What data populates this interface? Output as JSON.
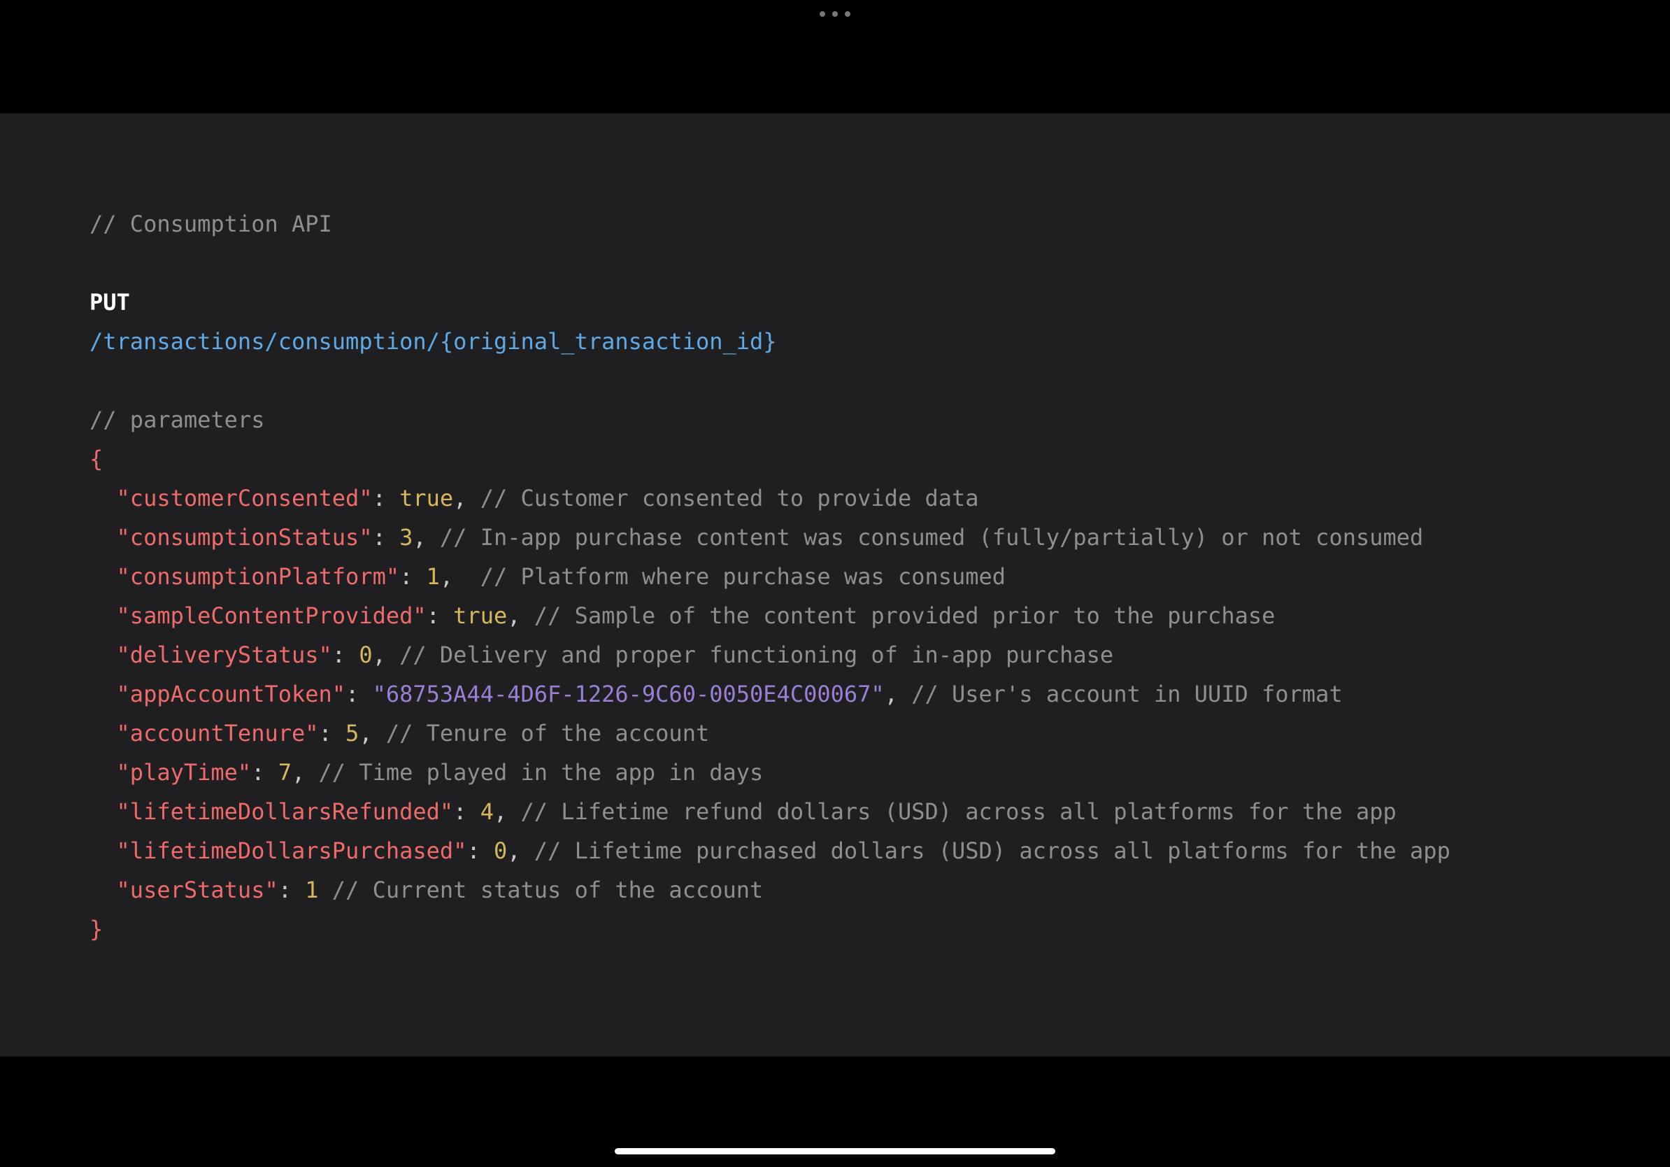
{
  "title_comment": "// Consumption API",
  "method": "PUT",
  "path": "/transactions/consumption/{original_transaction_id}",
  "params_comment": "// parameters",
  "brace_open": "{",
  "brace_close": "}",
  "indent": "  ",
  "entries": [
    {
      "key": "\"customerConsented\"",
      "value": "true",
      "vtype": "bool",
      "comma": ",",
      "gap": " ",
      "comment": "// Customer consented to provide data"
    },
    {
      "key": "\"consumptionStatus\"",
      "value": "3",
      "vtype": "num",
      "comma": ",",
      "gap": " ",
      "comment": "// In-app purchase content was consumed (fully/partially) or not consumed"
    },
    {
      "key": "\"consumptionPlatform\"",
      "value": "1",
      "vtype": "num",
      "comma": ",",
      "gap": "  ",
      "comment": "// Platform where purchase was consumed"
    },
    {
      "key": "\"sampleContentProvided\"",
      "value": "true",
      "vtype": "bool",
      "comma": ",",
      "gap": " ",
      "comment": "// Sample of the content provided prior to the purchase"
    },
    {
      "key": "\"deliveryStatus\"",
      "value": "0",
      "vtype": "num",
      "comma": ",",
      "gap": " ",
      "comment": "// Delivery and proper functioning of in-app purchase"
    },
    {
      "key": "\"appAccountToken\"",
      "value": "\"68753A44-4D6F-1226-9C60-0050E4C00067\"",
      "vtype": "str",
      "comma": ",",
      "gap": " ",
      "comment": "// User's account in UUID format"
    },
    {
      "key": "\"accountTenure\"",
      "value": "5",
      "vtype": "num",
      "comma": ",",
      "gap": " ",
      "comment": "// Tenure of the account"
    },
    {
      "key": "\"playTime\"",
      "value": "7",
      "vtype": "num",
      "comma": ",",
      "gap": " ",
      "comment": "// Time played in the app in days"
    },
    {
      "key": "\"lifetimeDollarsRefunded\"",
      "value": "4",
      "vtype": "num",
      "comma": ",",
      "gap": " ",
      "comment": "// Lifetime refund dollars (USD) across all platforms for the app"
    },
    {
      "key": "\"lifetimeDollarsPurchased\"",
      "value": "0",
      "vtype": "num",
      "comma": ",",
      "gap": " ",
      "comment": "// Lifetime purchased dollars (USD) across all platforms for the app"
    },
    {
      "key": "\"userStatus\"",
      "value": "1",
      "vtype": "num",
      "comma": "",
      "gap": " ",
      "comment": "// Current status of the account"
    }
  ]
}
